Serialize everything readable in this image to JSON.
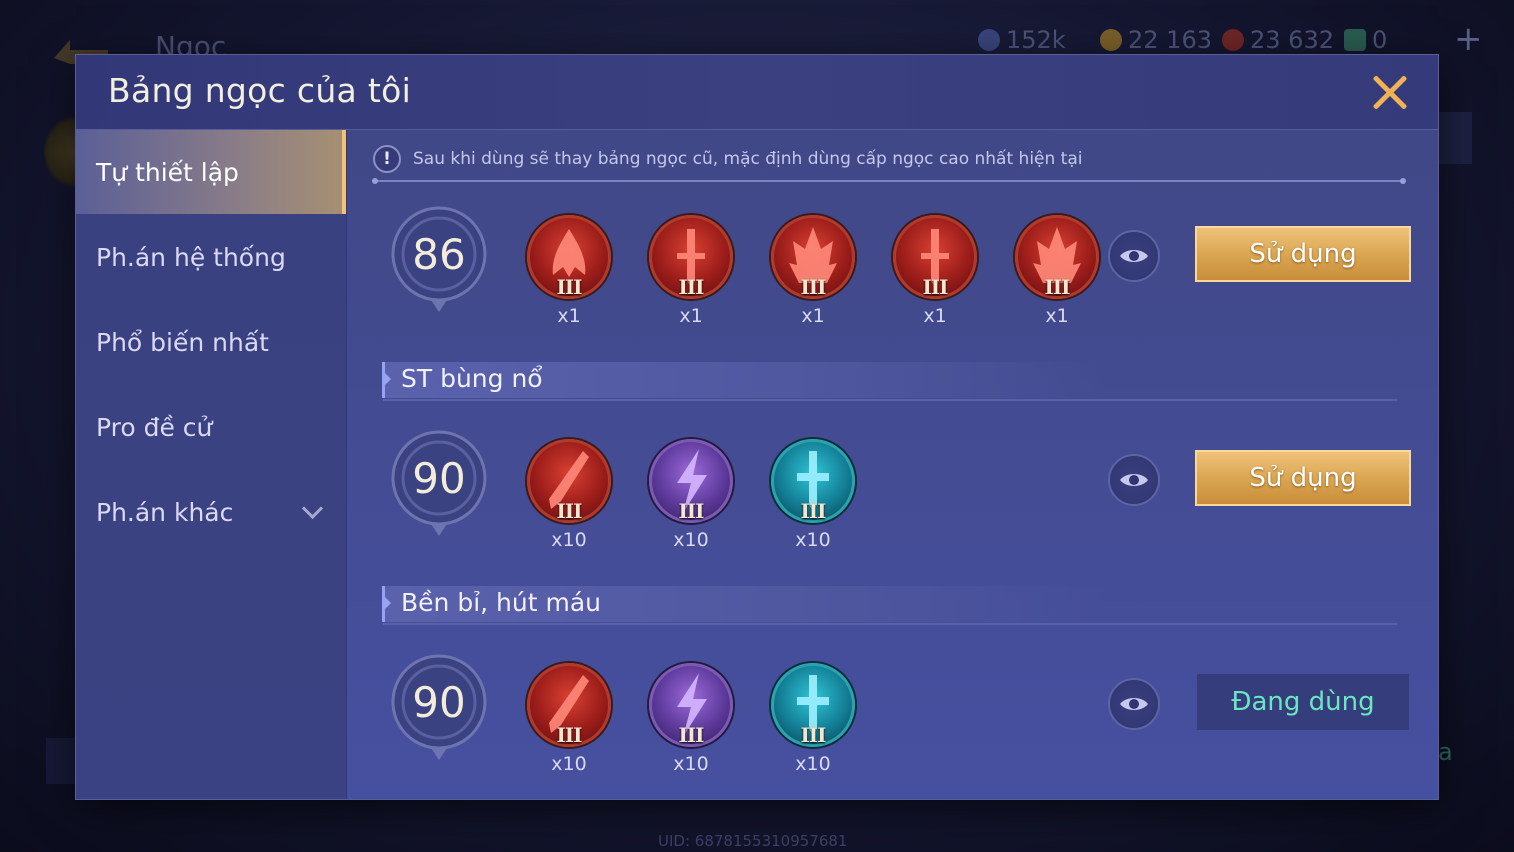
{
  "background": {
    "title": "Ngọc",
    "resources": [
      {
        "value": "152k",
        "color": "#3d4a80",
        "icon": "coin-blue-icon"
      },
      {
        "value": "22 163",
        "color": "#8a6a2e",
        "icon": "coin-gold-icon"
      },
      {
        "value": "23 632",
        "color": "#7a2a2a",
        "icon": "voucher-red-icon"
      },
      {
        "value": "0",
        "color": "#2e6a58",
        "icon": "ticket-green-icon"
      }
    ],
    "side_text": "a",
    "uid": "UID: 6878155310957681"
  },
  "modal": {
    "title": "Bảng ngọc của tôi"
  },
  "sidebar": {
    "items": [
      {
        "label": "Tự thiết lập",
        "active": true
      },
      {
        "label": "Ph.án hệ thống",
        "active": false
      },
      {
        "label": "Phổ biến nhất",
        "active": false
      },
      {
        "label": "Pro đề cử",
        "active": false
      },
      {
        "label": "Ph.án khác",
        "active": false,
        "has_dropdown": true
      }
    ]
  },
  "notice": {
    "icon": "!",
    "text": "Sau khi dùng sẽ thay bảng ngọc cũ, mặc định dùng cấp ngọc cao nhất hiện tại"
  },
  "pages": [
    {
      "name": "",
      "level": "86",
      "gems": [
        {
          "color": "red",
          "glyph": "claw",
          "tier": "III",
          "count": "x1"
        },
        {
          "color": "red",
          "glyph": "sword",
          "tier": "III",
          "count": "x1"
        },
        {
          "color": "red",
          "glyph": "flame",
          "tier": "III",
          "count": "x1"
        },
        {
          "color": "red",
          "glyph": "sword",
          "tier": "III",
          "count": "x1"
        },
        {
          "color": "red",
          "glyph": "flame",
          "tier": "III",
          "count": "x1"
        }
      ],
      "action": "Sử dụng",
      "in_use": false
    },
    {
      "name": "ST bùng nổ",
      "level": "90",
      "gems": [
        {
          "color": "red",
          "glyph": "blade",
          "tier": "III",
          "count": "x10"
        },
        {
          "color": "purple",
          "glyph": "bolt",
          "tier": "III",
          "count": "x10"
        },
        {
          "color": "teal",
          "glyph": "sword",
          "tier": "III",
          "count": "x10"
        }
      ],
      "action": "Sử dụng",
      "in_use": false
    },
    {
      "name": "Bền bỉ, hút máu",
      "level": "90",
      "gems": [
        {
          "color": "red",
          "glyph": "blade",
          "tier": "III",
          "count": "x10"
        },
        {
          "color": "purple",
          "glyph": "bolt",
          "tier": "III",
          "count": "x10"
        },
        {
          "color": "teal",
          "glyph": "sword",
          "tier": "III",
          "count": "x10"
        }
      ],
      "action": "Đang dùng",
      "in_use": true
    }
  ],
  "colors": {
    "accent_gold": "#f0b255",
    "in_use_text": "#6be7bf",
    "modal_bg": "#3e4580"
  }
}
